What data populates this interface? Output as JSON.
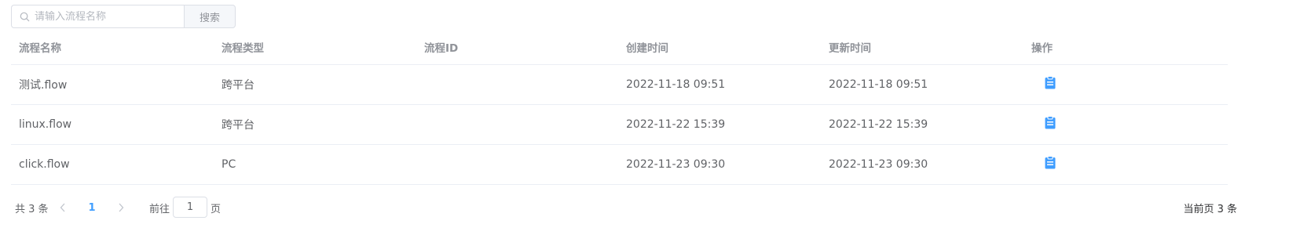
{
  "search": {
    "placeholder": "请输入流程名称",
    "button_label": "搜索"
  },
  "table": {
    "columns": [
      "流程名称",
      "流程类型",
      "流程ID",
      "创建时间",
      "更新时间",
      "操作"
    ],
    "rows": [
      {
        "name": "测试.flow",
        "type": "跨平台",
        "id": "",
        "created": "2022-11-18 09:51",
        "updated": "2022-11-18 09:51",
        "action_icon": "clipboard-icon"
      },
      {
        "name": "linux.flow",
        "type": "跨平台",
        "id": "",
        "created": "2022-11-22 15:39",
        "updated": "2022-11-22 15:39",
        "action_icon": "clipboard-icon"
      },
      {
        "name": "click.flow",
        "type": "PC",
        "id": "",
        "created": "2022-11-23 09:30",
        "updated": "2022-11-23 09:30",
        "action_icon": "clipboard-icon"
      }
    ]
  },
  "pagination": {
    "total_text": "共 3 条",
    "prev_icon": "chevron-left-icon",
    "current_page": "1",
    "next_icon": "chevron-right-icon",
    "goto_label": "前往",
    "goto_value": "1",
    "goto_suffix": "页",
    "current_page_count_text": "当前页 3 条"
  },
  "colors": {
    "accent": "#409eff",
    "icon": "#409eff",
    "border": "#ebeef5",
    "header_text": "#909399",
    "cell_text": "#606266"
  }
}
